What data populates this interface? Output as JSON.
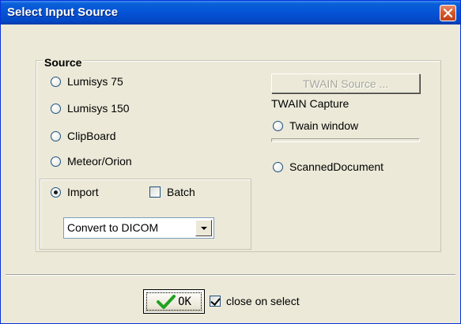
{
  "window": {
    "title": "Select Input Source"
  },
  "source_group": {
    "legend": "Source",
    "options": [
      {
        "label": "Lumisys 75",
        "selected": false
      },
      {
        "label": "Lumisys 150",
        "selected": false
      },
      {
        "label": "ClipBoard",
        "selected": false
      },
      {
        "label": "Meteor/Orion",
        "selected": false
      },
      {
        "label": "Import",
        "selected": true
      }
    ],
    "batch": {
      "label": "Batch",
      "checked": false
    },
    "convert_select": {
      "value": "Convert to DICOM"
    }
  },
  "twain": {
    "source_button_label": "TWAIN Source ...",
    "capture_label": "TWAIN Capture",
    "options": [
      {
        "label": "Twain window",
        "selected": false
      },
      {
        "label": "ScannedDocument",
        "selected": false
      }
    ]
  },
  "footer": {
    "ok_label": "OK",
    "close_on_select": {
      "label": "close on select",
      "checked": true
    }
  },
  "colors": {
    "title_bar": "#0553d6",
    "window_bg": "#ece9d8",
    "ok_check": "#21a121",
    "close_button": "#d75a2c"
  },
  "icons": {
    "close": "close-icon",
    "ok_check": "checkmark-icon",
    "dropdown": "chevron-down-icon"
  }
}
